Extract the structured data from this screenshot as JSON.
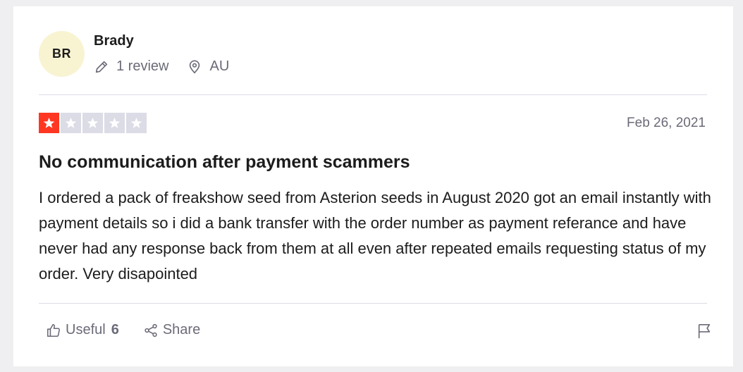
{
  "reviewer": {
    "initials": "BR",
    "name": "Brady",
    "review_count": "1 review",
    "country": "AU"
  },
  "review": {
    "rating": 1,
    "max_rating": 5,
    "date": "Feb 26, 2021",
    "title": "No communication after payment scammers",
    "body": "I ordered a pack of freakshow seed from Asterion seeds in August 2020 got an email instantly with payment details so i did a bank transfer with the order number as payment referance and have never had any response back from them at all even after repeated emails requesting status of my order. Very disapointed"
  },
  "actions": {
    "useful_label": "Useful",
    "useful_count": "6",
    "share_label": "Share"
  },
  "colors": {
    "star_on": "#ff3722",
    "star_off": "#dcdce6",
    "avatar_bg": "#f8f4d2"
  }
}
